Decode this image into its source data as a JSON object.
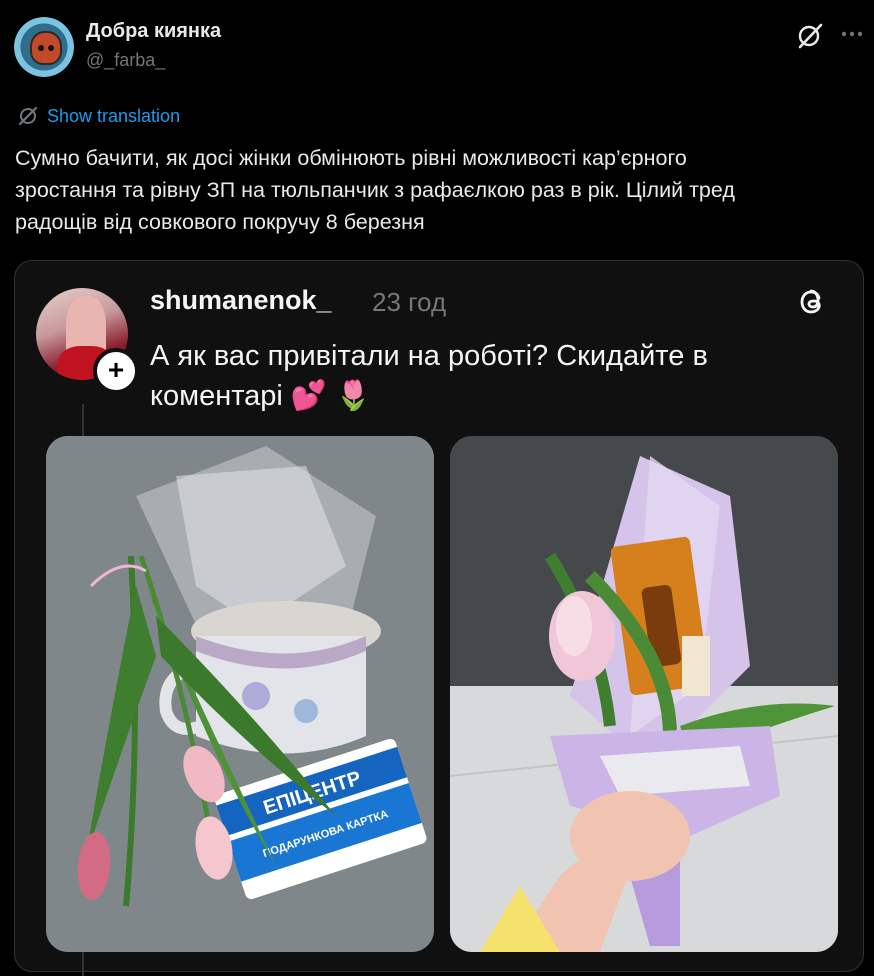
{
  "tweet": {
    "display_name": "Добра киянка",
    "handle": "@_farba_",
    "translate_label": "Show translation",
    "text": "Сумно бачити, як досі жінки обмінюють рівні можливості кар’єрного\nзростання та рівну ЗП на тюльпанчик з рафаєлкою раз в рік. Цілий тред\nрадощів від совкового покручу 8 березня"
  },
  "embedded_post": {
    "username": "shumanenok_",
    "time": "23 год",
    "text": "А як вас привітали на роботі? Скидайте в\nкоментарі 💕 🌷",
    "plus_label": "+",
    "gift_card_brand": "ЕПІЦЕНТР",
    "gift_card_label": "ПОДАРУНКОВА КАРТКА"
  },
  "colors": {
    "accent": "#1d9bf0",
    "background": "#000000",
    "card_background": "#101010",
    "muted": "#71767b"
  },
  "icons": [
    "grok-icon",
    "more-icon",
    "translate-icon",
    "threads-icon",
    "plus-icon"
  ]
}
